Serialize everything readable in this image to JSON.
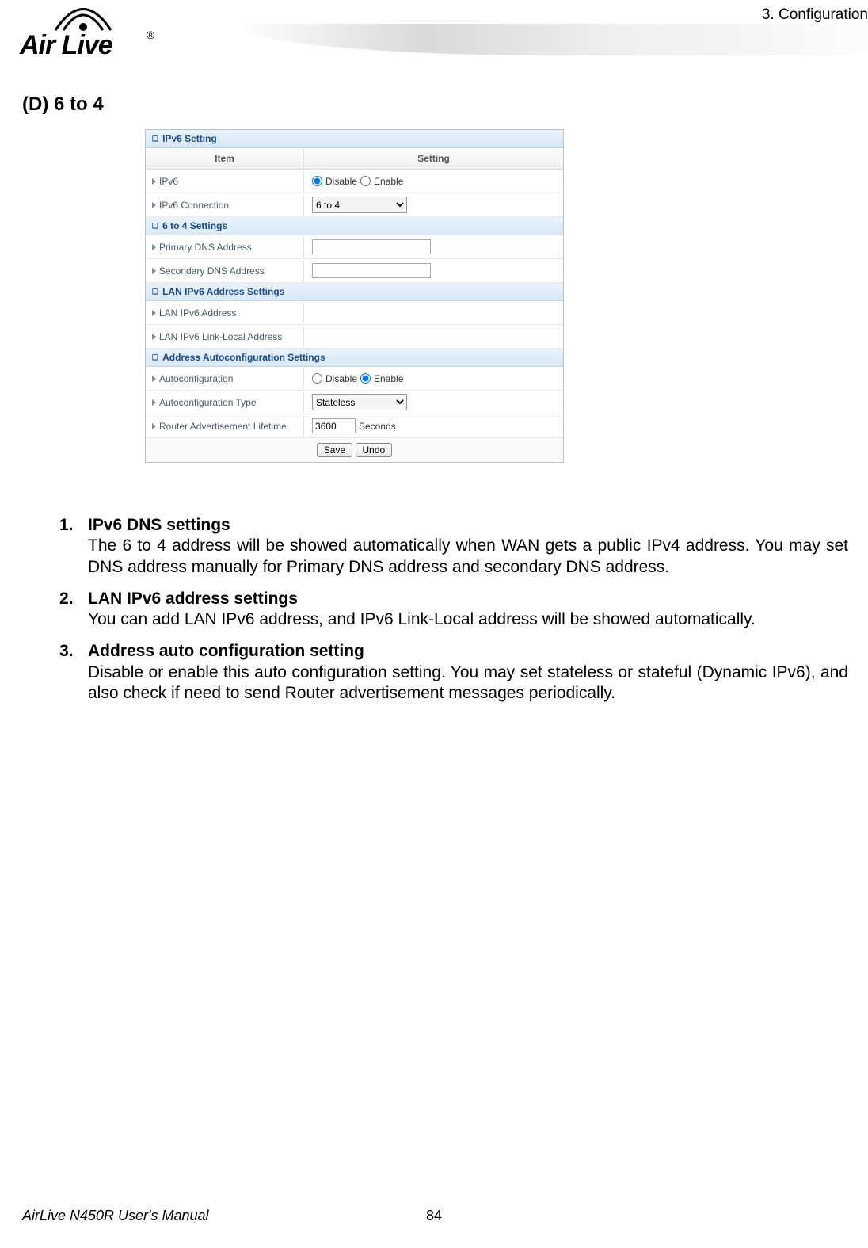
{
  "header": {
    "chapter": "3.  Configuration",
    "logo_text": "Air Live",
    "logo_reg": "®"
  },
  "section_heading": "(D)   6 to 4",
  "screenshot": {
    "sections": {
      "ipv6_setting": "IPv6 Setting",
      "six_to_four": "6 to 4 Settings",
      "lan_ipv6": "LAN IPv6 Address Settings",
      "autoconf": "Address Autoconfiguration Settings"
    },
    "columns": {
      "item": "Item",
      "setting": "Setting"
    },
    "rows": {
      "ipv6": {
        "label": "IPv6",
        "disable": "Disable",
        "enable": "Enable",
        "selected": "disable"
      },
      "ipv6_conn": {
        "label": "IPv6 Connection",
        "value": "6 to 4"
      },
      "pri_dns": {
        "label": "Primary DNS Address",
        "value": ""
      },
      "sec_dns": {
        "label": "Secondary DNS Address",
        "value": ""
      },
      "lan_addr": {
        "label": "LAN IPv6 Address",
        "value": ""
      },
      "lan_link": {
        "label": "LAN IPv6 Link-Local Address",
        "value": ""
      },
      "autoconf": {
        "label": "Autoconfiguration",
        "disable": "Disable",
        "enable": "Enable",
        "selected": "enable"
      },
      "autoconf_type": {
        "label": "Autoconfiguration Type",
        "value": "Stateless"
      },
      "router_adv": {
        "label": "Router Advertisement Lifetime",
        "value": "3600",
        "unit": "Seconds"
      }
    },
    "buttons": {
      "save": "Save",
      "undo": "Undo"
    }
  },
  "body": {
    "items": [
      {
        "num": "1.",
        "title": "IPv6 DNS settings",
        "text": "The 6 to 4 address will be showed automatically when WAN gets a public IPv4 address. You may set DNS address manually for Primary DNS address and secondary DNS address."
      },
      {
        "num": "2.",
        "title": "LAN IPv6 address settings",
        "text": "You can add LAN IPv6 address, and IPv6 Link-Local address will be showed automatically."
      },
      {
        "num": "3.",
        "title": "Address auto configuration setting",
        "text": "Disable or enable this auto configuration setting. You may set stateless or stateful (Dynamic IPv6), and also check if need to send Router advertisement messages periodically."
      }
    ]
  },
  "footer": {
    "manual": "AirLive N450R User's Manual",
    "page": "84"
  }
}
